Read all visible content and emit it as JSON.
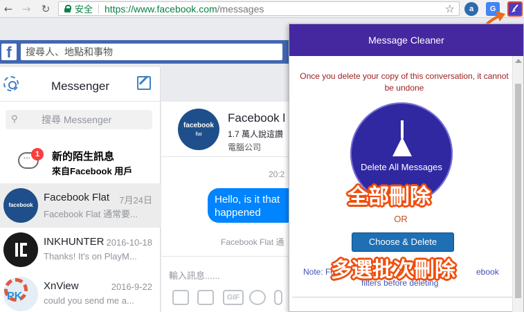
{
  "browser": {
    "secure_label": "安全",
    "url_scheme_host": "https://www.facebook.com",
    "url_path": "/messages",
    "ext_translate_label": "G"
  },
  "facebook": {
    "logo": "f",
    "search_placeholder": "搜尋人、地點和事物"
  },
  "messenger": {
    "title": "Messenger",
    "search_placeholder": "搜尋 Messenger",
    "new_requests": {
      "badge": "1",
      "line1": "新的陌生訊息",
      "line2": "來自Facebook 用戶"
    },
    "conversations": [
      {
        "name": "Facebook Flat",
        "date": "7月24日",
        "snippet": "Facebook Flat 通常要...",
        "avatar_text": "facebook"
      },
      {
        "name": "INKHUNTER",
        "date": "2016-10-18",
        "snippet": "Thanks! It's on PlayM...",
        "avatar_text": ""
      },
      {
        "name": "XnView",
        "date": "2016-9-22",
        "snippet": "could you send me a...",
        "avatar_text": ""
      }
    ]
  },
  "conversation": {
    "avatar_text": "facebook",
    "avatar_sub": "flat",
    "name": "Facebook l",
    "sub1": "1.7 萬人說這讚",
    "sub2": "電腦公司",
    "time": "20:2",
    "message": "Hello, is it that happened",
    "message_line1": "Hello, is it that",
    "message_line2": "happened",
    "seen": "Facebook Flat 通",
    "input_placeholder": "輸入訊息......",
    "gif_label": "GIF"
  },
  "popup": {
    "title": "Message Cleaner",
    "warning": "Once you delete your copy of this conversation, it cannot be undone",
    "delete_all_label": "Delete All Messages",
    "or_label": "OR",
    "choose_delete_label": "Choose & Delete",
    "note_start": "Note: Fo",
    "note_end": "ebook",
    "note_line2": "filters before deleting",
    "overlay_delete_all": "全部刪除",
    "overlay_multi_delete": "多選批次刪除"
  },
  "watermark": {
    "text": "PK"
  },
  "colors": {
    "facebook_blue": "#4267b2",
    "messenger_blue": "#0084ff",
    "popup_purple": "#4527a0",
    "circle_blue": "#3028a0",
    "button_blue": "#1e6fb3",
    "overlay_orange": "#f04d0c"
  }
}
